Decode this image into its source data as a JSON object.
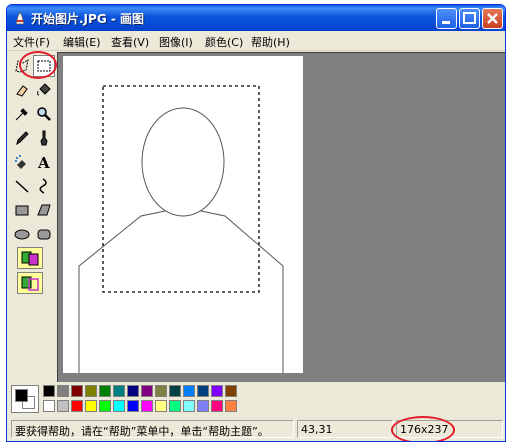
{
  "window": {
    "title": "开始图片.JPG - 画图"
  },
  "menu": [
    "文件(F)",
    "编辑(E)",
    "查看(V)",
    "图像(I)",
    "颜色(C)",
    "帮助(H)"
  ],
  "toolbox": {
    "tools": [
      "free-select-icon",
      "rect-select-icon",
      "eraser-icon",
      "fill-icon",
      "color-picker-icon",
      "magnifier-icon",
      "pencil-icon",
      "brush-icon",
      "airbrush-icon",
      "text-icon",
      "line-icon",
      "curve-icon",
      "rectangle-icon",
      "polygon-icon",
      "ellipse-icon",
      "rounded-rect-icon"
    ],
    "selected": "rect-select-icon",
    "options": [
      "opaque-mode-icon",
      "transparent-mode-icon"
    ]
  },
  "palette": {
    "foreground": "#000000",
    "background": "#ffffff",
    "colors_top": [
      "#000000",
      "#808080",
      "#800000",
      "#808000",
      "#008000",
      "#008080",
      "#000080",
      "#800080",
      "#808040",
      "#004040",
      "#0080ff",
      "#004080",
      "#8000ff",
      "#804000"
    ],
    "colors_bottom": [
      "#ffffff",
      "#c0c0c0",
      "#ff0000",
      "#ffff00",
      "#00ff00",
      "#00ffff",
      "#0000ff",
      "#ff00ff",
      "#ffff80",
      "#00ff80",
      "#80ffff",
      "#8080ff",
      "#ff0080",
      "#ff8040"
    ]
  },
  "statusbar": {
    "help_text": "要获得帮助，请在“帮助”菜单中，单击“帮助主题”。",
    "cursor_pos": "43,31",
    "selection_size": "176x237"
  },
  "colors": {
    "annotation_red": "#e21c2a",
    "workspace_gray": "#808080"
  }
}
